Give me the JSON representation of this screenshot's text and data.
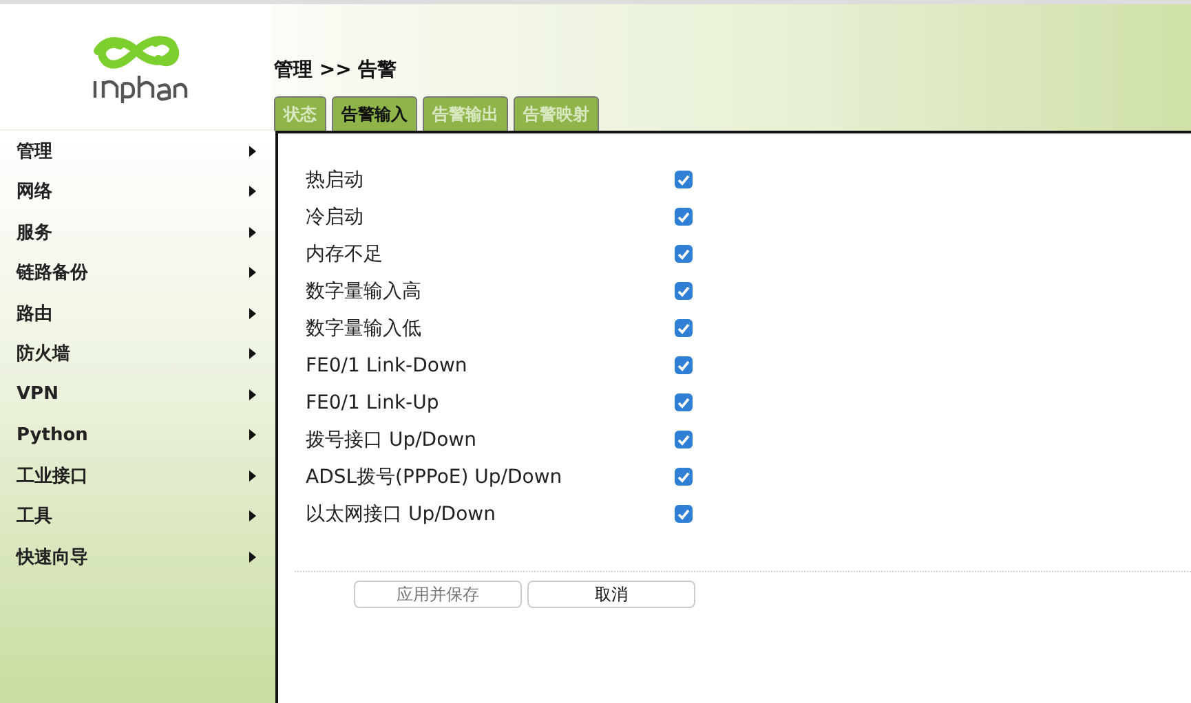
{
  "breadcrumb": "管理 >> 告警",
  "tabs": [
    {
      "label": "状态",
      "selected": false
    },
    {
      "label": "告警输入",
      "selected": true
    },
    {
      "label": "告警输出",
      "selected": false
    },
    {
      "label": "告警映射",
      "selected": false
    }
  ],
  "sidebar": {
    "items": [
      {
        "label": "管理"
      },
      {
        "label": "网络"
      },
      {
        "label": "服务"
      },
      {
        "label": "链路备份"
      },
      {
        "label": "路由"
      },
      {
        "label": "防火墙"
      },
      {
        "label": "VPN"
      },
      {
        "label": "Python"
      },
      {
        "label": "工业接口"
      },
      {
        "label": "工具"
      },
      {
        "label": "快速向导"
      }
    ]
  },
  "alarms": [
    {
      "label": "热启动",
      "checked": true
    },
    {
      "label": "冷启动",
      "checked": true
    },
    {
      "label": "内存不足",
      "checked": true
    },
    {
      "label": "数字量输入高",
      "checked": true
    },
    {
      "label": "数字量输入低",
      "checked": true
    },
    {
      "label": "FE0/1 Link-Down",
      "checked": true
    },
    {
      "label": "FE0/1 Link-Up",
      "checked": true
    },
    {
      "label": "拨号接口 Up/Down",
      "checked": true
    },
    {
      "label": "ADSL拨号(PPPoE) Up/Down",
      "checked": true
    },
    {
      "label": "以太网接口 Up/Down",
      "checked": true
    }
  ],
  "buttons": [
    {
      "label": "应用并保存",
      "disabled": true
    },
    {
      "label": "取消",
      "disabled": false
    }
  ]
}
